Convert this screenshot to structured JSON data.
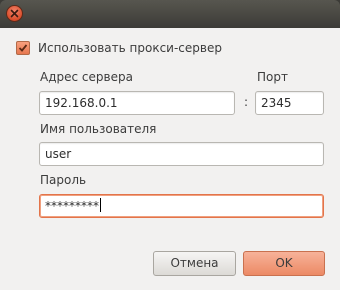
{
  "use_proxy": {
    "label": "Использовать прокси-сервер",
    "checked": true
  },
  "server": {
    "label": "Адрес сервера",
    "value": "192.168.0.1"
  },
  "separator": ":",
  "port": {
    "label": "Порт",
    "value": "2345"
  },
  "username": {
    "label": "Имя пользователя",
    "value": "user"
  },
  "password": {
    "label": "Пароль",
    "value": "*********"
  },
  "buttons": {
    "cancel": "Отмена",
    "ok": "OK"
  },
  "colors": {
    "accent": "#e7774f",
    "titlebar": "#3c3b37",
    "dialog_bg": "#f2f1f0"
  }
}
